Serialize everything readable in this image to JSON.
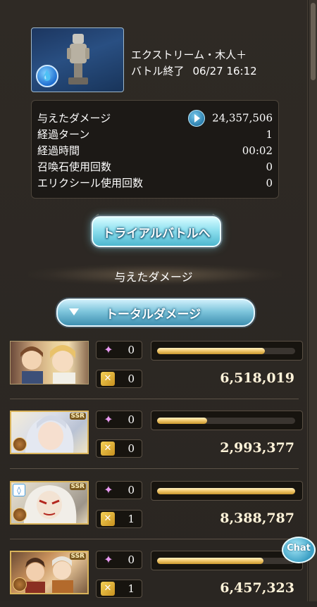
{
  "quest": {
    "title": "エクストリーム・木人＋",
    "status": "バトル終了",
    "datetime": "06/27 16:12",
    "element_icon": "water-element-icon"
  },
  "summary": {
    "damage_label": "与えたダメージ",
    "damage_value": "24,357,506",
    "turns_label": "経過ターン",
    "turns_value": "1",
    "time_label": "経過時間",
    "time_value": "00:02",
    "summon_label": "召喚石使用回数",
    "summon_value": "0",
    "elixir_label": "エリクシール使用回数",
    "elixir_value": "0"
  },
  "trial_button_label": "トライアルバトルへ",
  "section_title": "与えたダメージ",
  "total_select_label": "トータルダメージ",
  "chat_label": "Chat",
  "characters": [
    {
      "skill_count": "0",
      "ougi_count": "0",
      "damage": "6,518,019",
      "share": 0.78
    },
    {
      "skill_count": "0",
      "ougi_count": "0",
      "damage": "2,993,377",
      "share": 0.36,
      "rarity": "SSR"
    },
    {
      "skill_count": "0",
      "ougi_count": "1",
      "damage": "8,388,787",
      "share": 1.0,
      "rarity": "SSR"
    },
    {
      "skill_count": "0",
      "ougi_count": "1",
      "damage": "6,457,323",
      "share": 0.77,
      "rarity": "SSR"
    }
  ],
  "colors": {
    "accent_cyan": "#7ec5dc",
    "bar_gold": "#f0c66a",
    "panel_bg": "#2b2723"
  }
}
